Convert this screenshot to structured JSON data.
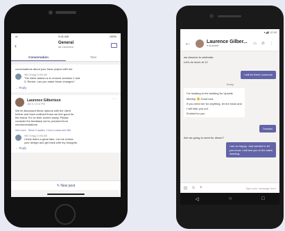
{
  "iphone": {
    "status": {
      "left": "•ıl",
      "center": "9:41 AM",
      "right": "100%"
    },
    "header": {
      "back": "‹",
      "title": "General",
      "subtitle": "All members"
    },
    "tabs": [
      {
        "label": "Conversation"
      },
      {
        "label": "Tabs"
      }
    ],
    "card1": {
      "lines": [
        "conversations about your track project with me"
      ],
      "reply": {
        "meta": "Will Gregg 10:55 AM",
        "text1": "The client asked us to remove sections 2 and",
        "text2": "3. Renee, can you make those changes?"
      },
      "reply_link": "← Reply"
    },
    "card2": {
      "author": "Laurence Gilbertson",
      "time": "Jan 5, 10:42 PM",
      "lines": [
        "We've discussed these options with the client",
        "before and have outlined those we feel good for",
        "the brand. It's on their screen today. Please",
        "consider the feedback we've provided from",
        "recommendations."
      ],
      "see_more": "See more · Show 3 replies, 2 from Louisa and Will",
      "reply": {
        "meta": "Will Gregg 10:55 AM",
        "text1": "I think that's a great idea. Let me review",
        "text2": "your design and get back with my thoughts."
      },
      "reply_link": "← Reply"
    },
    "new_post": "✎ New post"
  },
  "android": {
    "status": "▾◢▮ 12:30",
    "header": {
      "back": "←",
      "name": "Laurence Gilber...",
      "presence": "● Available",
      "icons": "▭ ✆ ⋮"
    },
    "messages_in_top": [
      "we deserve to celebrate.",
      "Let's do lunch at 12"
    ],
    "out1": "I will be there Laurence",
    "divider": "Today",
    "in_block": [
      "I'm heading to the building for Upsells",
      "Meetup 🙂 Good luck",
      "If you need me for anything, let me know and",
      "I will help you out.",
      "Excited for you"
    ],
    "out2": "Thanks!",
    "in_last": "Are we going to meet for dinner?",
    "out3": [
      "I am so happy. Just wanted to let",
      "you know I will see you in the sales",
      "meeting."
    ],
    "compose_placeholder": "Type your message here",
    "nav": {
      "back": "◁",
      "home": "○",
      "recent": "□"
    }
  },
  "colors": {
    "accent": "#6264a7"
  }
}
